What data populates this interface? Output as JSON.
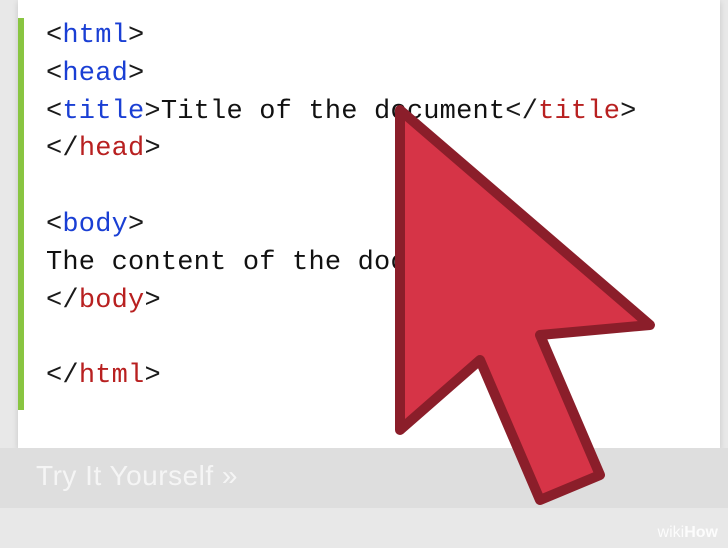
{
  "code": {
    "line1_tag": "html",
    "line2_tag": "head",
    "line3_tag_open": "title",
    "line3_text": "Title of the document",
    "line3_tag_close": "title",
    "line4_tag_close": "head",
    "line6_tag": "body",
    "line7_text": "The content of the document......",
    "line8_tag_close": "body",
    "line10_tag_close": "html"
  },
  "caption": "Try It Yourself »",
  "watermark_prefix": "wiki",
  "watermark_suffix": "How",
  "colors": {
    "tag_open": "#1a3fd4",
    "tag_close": "#b82020",
    "accent_bar": "#89c541",
    "cursor_fill": "#d63447",
    "cursor_stroke": "#8b1e2a"
  }
}
